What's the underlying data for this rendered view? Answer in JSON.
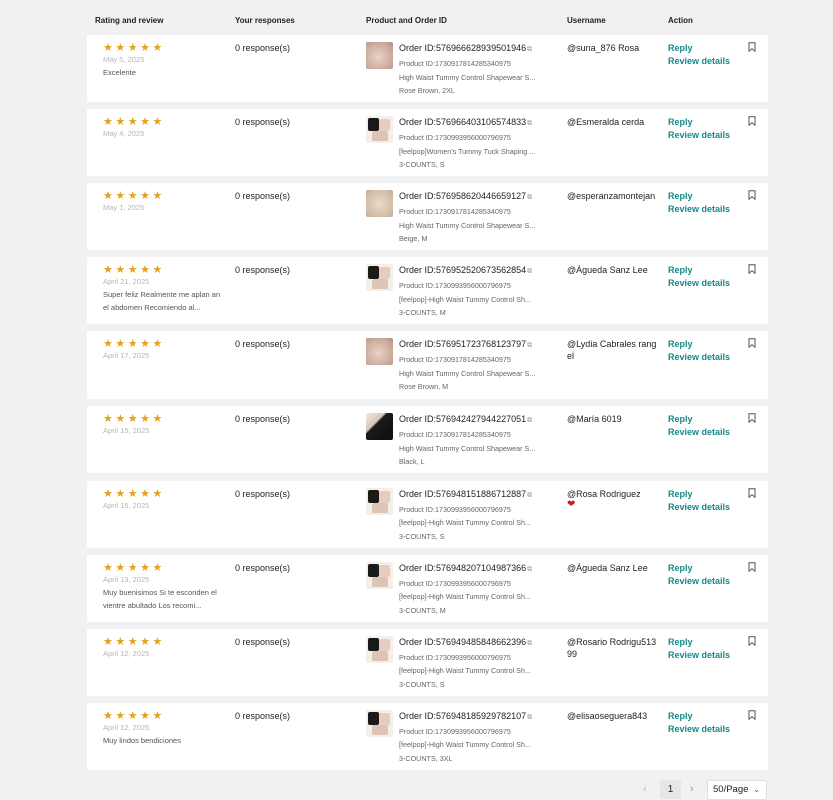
{
  "header": {
    "rating": "Rating and review",
    "responses": "Your responses",
    "product": "Product and Order ID",
    "username": "Username",
    "action": "Action"
  },
  "reviews": [
    {
      "stars": "★★★★★",
      "date": "May 5, 2025",
      "comment": "Excelente",
      "responses": "0 response(s)",
      "order_id": "Order ID:576966628939501946",
      "product_id": "Product ID:1730917814285340975",
      "product_name": "High Waist Tummy Control Shapewear S...",
      "variant": "Rose Brown, 2XL",
      "thumb": "skin",
      "username": "@suna_876 Rosa",
      "heart": "",
      "reply": "Reply",
      "details": "Review details"
    },
    {
      "stars": "★★★★★",
      "date": "May 4, 2025",
      "comment": "",
      "responses": "0 response(s)",
      "order_id": "Order ID:576966403106574833",
      "product_id": "Product ID:1730993956000796975",
      "product_name": "[feelpop]Women's Tummy Tuck Shaping ...",
      "variant": "3-COUNTS, S",
      "thumb": "multi",
      "username": "@Esmeralda cerda",
      "heart": "",
      "reply": "Reply",
      "details": "Review details"
    },
    {
      "stars": "★★★★★",
      "date": "May 1, 2025",
      "comment": "",
      "responses": "0 response(s)",
      "order_id": "Order ID:576958620446659127",
      "product_id": "Product ID:1730917814285340975",
      "product_name": "High Waist Tummy Control Shapewear S...",
      "variant": "Beige, M",
      "thumb": "beige",
      "username": "@esperanzamontejan",
      "heart": "",
      "reply": "Reply",
      "details": "Review details"
    },
    {
      "stars": "★★★★★",
      "date": "April 21, 2025",
      "comment": "Super feliz Realmente me aplan an el abdomen Recomiendo al...",
      "responses": "0 response(s)",
      "order_id": "Order ID:576952520673562854",
      "product_id": "Product ID:1730993956000796975",
      "product_name": "[feelpop]-High Waist Tummy Control Sh...",
      "variant": "3-COUNTS, M",
      "thumb": "multi",
      "username": "@Águeda Sanz Lee",
      "heart": "",
      "reply": "Reply",
      "details": "Review details"
    },
    {
      "stars": "★★★★★",
      "date": "April 17, 2025",
      "comment": "",
      "responses": "0 response(s)",
      "order_id": "Order ID:576951723768123797",
      "product_id": "Product ID:1730917814285340975",
      "product_name": "High Waist Tummy Control Shapewear S...",
      "variant": "Rose Brown, M",
      "thumb": "skin",
      "username": "@Lydia Cabrales rangel",
      "heart": "",
      "reply": "Reply",
      "details": "Review details"
    },
    {
      "stars": "★★★★★",
      "date": "April 15, 2025",
      "comment": "",
      "responses": "0 response(s)",
      "order_id": "Order ID:576942427944227051",
      "product_id": "Product ID:1730917814285340975",
      "product_name": "High Waist Tummy Control Shapewear S...",
      "variant": "Black, L",
      "thumb": "black",
      "username": "@María 6019",
      "heart": "",
      "reply": "Reply",
      "details": "Review details"
    },
    {
      "stars": "★★★★★",
      "date": "April 15, 2025",
      "comment": "",
      "responses": "0 response(s)",
      "order_id": "Order ID:576948151886712887",
      "product_id": "Product ID:1730993956000796975",
      "product_name": "[feelpop]-High Waist Tummy Control Sh...",
      "variant": "3-COUNTS, S",
      "thumb": "multi",
      "username": "@Rosa Rodriguez",
      "heart": "❤",
      "reply": "Reply",
      "details": "Review details"
    },
    {
      "stars": "★★★★★",
      "date": "April 13, 2025",
      "comment": "Muy buenisimos Si te esconden el vientre abultado Los recomi...",
      "responses": "0 response(s)",
      "order_id": "Order ID:576948207104987366",
      "product_id": "Product ID:1730993956000796975",
      "product_name": "[feelpop]-High Waist Tummy Control Sh...",
      "variant": "3-COUNTS, M",
      "thumb": "multi",
      "username": "@Águeda Sanz Lee",
      "heart": "",
      "reply": "Reply",
      "details": "Review details"
    },
    {
      "stars": "★★★★★",
      "date": "April 12, 2025",
      "comment": "",
      "responses": "0 response(s)",
      "order_id": "Order ID:576949485848662396",
      "product_id": "Product ID:1730993956000796975",
      "product_name": "[feelpop]-High Waist Tummy Control Sh...",
      "variant": "3-COUNTS, S",
      "thumb": "multi",
      "username": "@Rosario Rodrigu51399",
      "heart": "",
      "reply": "Reply",
      "details": "Review details"
    },
    {
      "stars": "★★★★★",
      "date": "April 12, 2025",
      "comment": "Muy lindos bendiciones",
      "responses": "0 response(s)",
      "order_id": "Order ID:576948185929782107",
      "product_id": "Product ID:1730993956000796975",
      "product_name": "[feelpop]-High Waist Tummy Control Sh...",
      "variant": "3-COUNTS, 3XL",
      "thumb": "multi",
      "username": "@elisaoseguera843",
      "heart": "",
      "reply": "Reply",
      "details": "Review details"
    }
  ],
  "pagination": {
    "prev": "‹",
    "current": "1",
    "next": "›",
    "page_size": "50/Page"
  }
}
